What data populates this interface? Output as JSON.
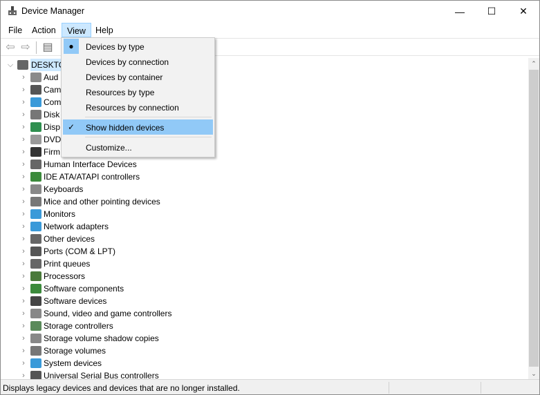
{
  "window": {
    "title": "Device Manager",
    "minimize": "—",
    "maximize": "☐",
    "close": "✕"
  },
  "menubar": [
    "File",
    "Action",
    "View",
    "Help"
  ],
  "toolbar": {
    "back": "⇦",
    "forward": "⇨",
    "properties": "▤"
  },
  "view_menu": {
    "items": [
      {
        "label": "Devices by type",
        "mark": "●"
      },
      {
        "label": "Devices by connection",
        "mark": ""
      },
      {
        "label": "Devices by container",
        "mark": ""
      },
      {
        "label": "Resources by type",
        "mark": ""
      },
      {
        "label": "Resources by connection",
        "mark": ""
      },
      {
        "label": "Show hidden devices",
        "mark": "✓"
      },
      {
        "label": "Customize...",
        "mark": ""
      }
    ]
  },
  "tree": {
    "root": "DESKTO",
    "children": [
      {
        "label": "Aud",
        "color": "#8a8a8a"
      },
      {
        "label": "Cam",
        "color": "#555"
      },
      {
        "label": "Com",
        "color": "#3a9ad9"
      },
      {
        "label": "Disk",
        "color": "#777"
      },
      {
        "label": "Disp",
        "color": "#2f8f4f"
      },
      {
        "label": "DVD",
        "color": "#999"
      },
      {
        "label": "Firm",
        "color": "#333"
      },
      {
        "label": "Human Interface Devices",
        "color": "#666"
      },
      {
        "label": "IDE ATA/ATAPI controllers",
        "color": "#3b8a3b"
      },
      {
        "label": "Keyboards",
        "color": "#888"
      },
      {
        "label": "Mice and other pointing devices",
        "color": "#777"
      },
      {
        "label": "Monitors",
        "color": "#3a9ad9"
      },
      {
        "label": "Network adapters",
        "color": "#3a9ad9"
      },
      {
        "label": "Other devices",
        "color": "#666"
      },
      {
        "label": "Ports (COM & LPT)",
        "color": "#555"
      },
      {
        "label": "Print queues",
        "color": "#666"
      },
      {
        "label": "Processors",
        "color": "#4a7a3a"
      },
      {
        "label": "Software components",
        "color": "#3b8a3b"
      },
      {
        "label": "Software devices",
        "color": "#444"
      },
      {
        "label": "Sound, video and game controllers",
        "color": "#888"
      },
      {
        "label": "Storage controllers",
        "color": "#5a8a5a"
      },
      {
        "label": "Storage volume shadow copies",
        "color": "#888"
      },
      {
        "label": "Storage volumes",
        "color": "#777"
      },
      {
        "label": "System devices",
        "color": "#3a9ad9"
      },
      {
        "label": "Universal Serial Bus controllers",
        "color": "#555"
      }
    ]
  },
  "status": {
    "text": "Displays legacy devices and devices that are no longer installed."
  }
}
